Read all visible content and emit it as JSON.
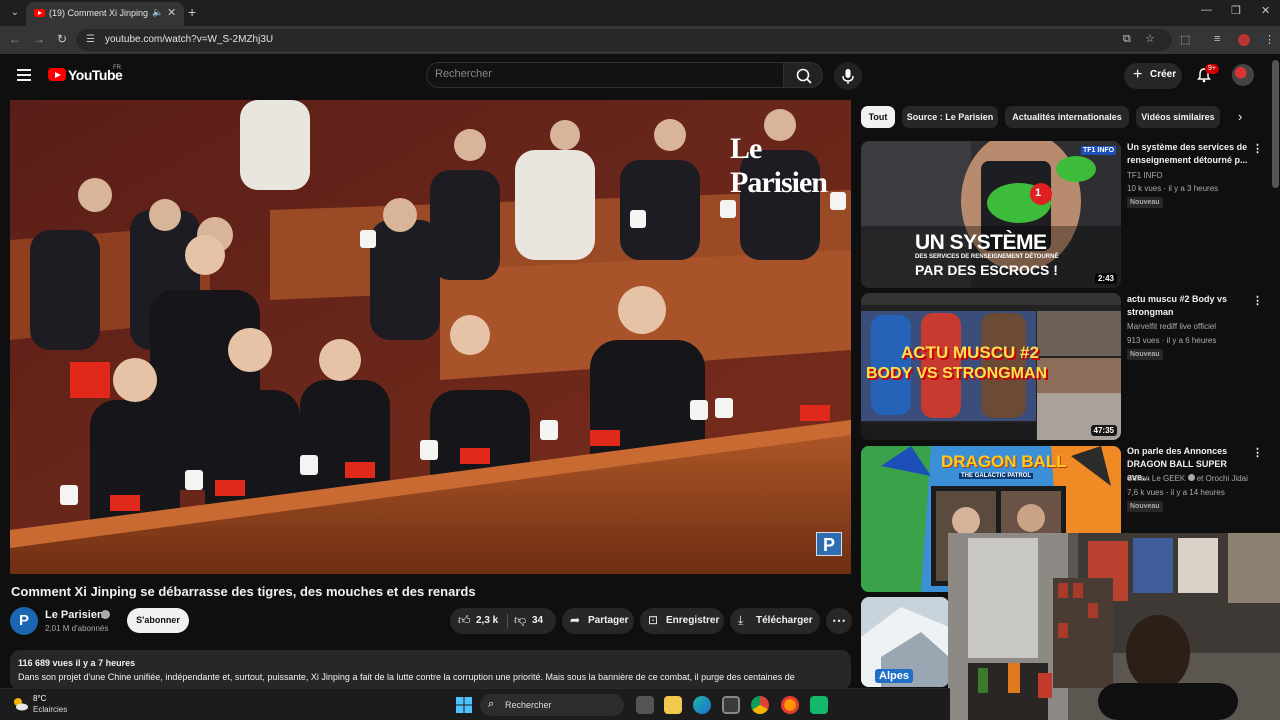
{
  "browser": {
    "tab_title": "(19) Comment Xi Jinping se débarrasse",
    "url": "youtube.com/watch?v=W_S-2MZhj3U"
  },
  "masthead": {
    "logo_text": "YouTube",
    "country": "FR",
    "search_placeholder": "Rechercher",
    "create_label": "Créer",
    "notification_count": "9+"
  },
  "video": {
    "watermark": "Le Parisien",
    "corner_logo": "P",
    "title": "Comment Xi Jinping se débarrasse des tigres, des mouches et des renards",
    "channel": "Le Parisien",
    "channel_initial": "P",
    "subscribers": "2,01 M d'abonnés",
    "subscribe_label": "S'abonner",
    "likes": "2,3 k",
    "dislikes": "34",
    "share_label": "Partager",
    "save_label": "Enregistrer",
    "download_label": "Télécharger",
    "views_time": "116 689 vues  il y a 7 heures",
    "description": "Dans son projet d'une Chine unifiée, indépendante et, surtout, puissante, Xi Jinping a fait de la lutte contre la corruption une priorité. Mais sous la bannière de ce combat, il purge des centaines de"
  },
  "chips": [
    {
      "label": "Tout",
      "active": true
    },
    {
      "label": "Source : Le Parisien",
      "active": false
    },
    {
      "label": "Actualités internationales",
      "active": false
    },
    {
      "label": "Vidéos similaires",
      "active": false
    }
  ],
  "recommendations": [
    {
      "title": "Un système des services de renseignement détourné p...",
      "channel": "TF1 INFO",
      "views": "10 k vues · il y a 3 heures",
      "badge": "Nouveau",
      "duration": "2:43",
      "thumb_line1": "UN SYSTÈME",
      "thumb_line2": "DES SERVICES DE RENSEIGNEMENT DÉTOURNÉ",
      "thumb_line3": "PAR DES ESCROCS !",
      "thumb_logo": "TF1 INFO",
      "thumb_bubble": "1"
    },
    {
      "title": "actu muscu #2 Body vs strongman",
      "channel": "Marvelfit rediff live officiel",
      "views": "913 vues · il y a 6 heures",
      "badge": "Nouveau",
      "duration": "47:35",
      "thumb_line1": "ACTU MUSCU #2",
      "thumb_line2": "BODY VS STRONGMAN"
    },
    {
      "title": "On parle des Annonces DRAGON BALL SUPER ave...",
      "channel": "Sofian Le GEEK",
      "channel_extra": "et Orochi Jidai",
      "views": "7,6 k vues · il y a 14 heures",
      "badge": "Nouveau",
      "thumb_logo": "DRAGON BALL",
      "thumb_sub": "THE GALACTIC PATROL"
    },
    {
      "thumb_label": "Alpes"
    }
  ],
  "taskbar": {
    "temperature": "8°C",
    "weather": "Eclaircies",
    "search_label": "Rechercher"
  }
}
